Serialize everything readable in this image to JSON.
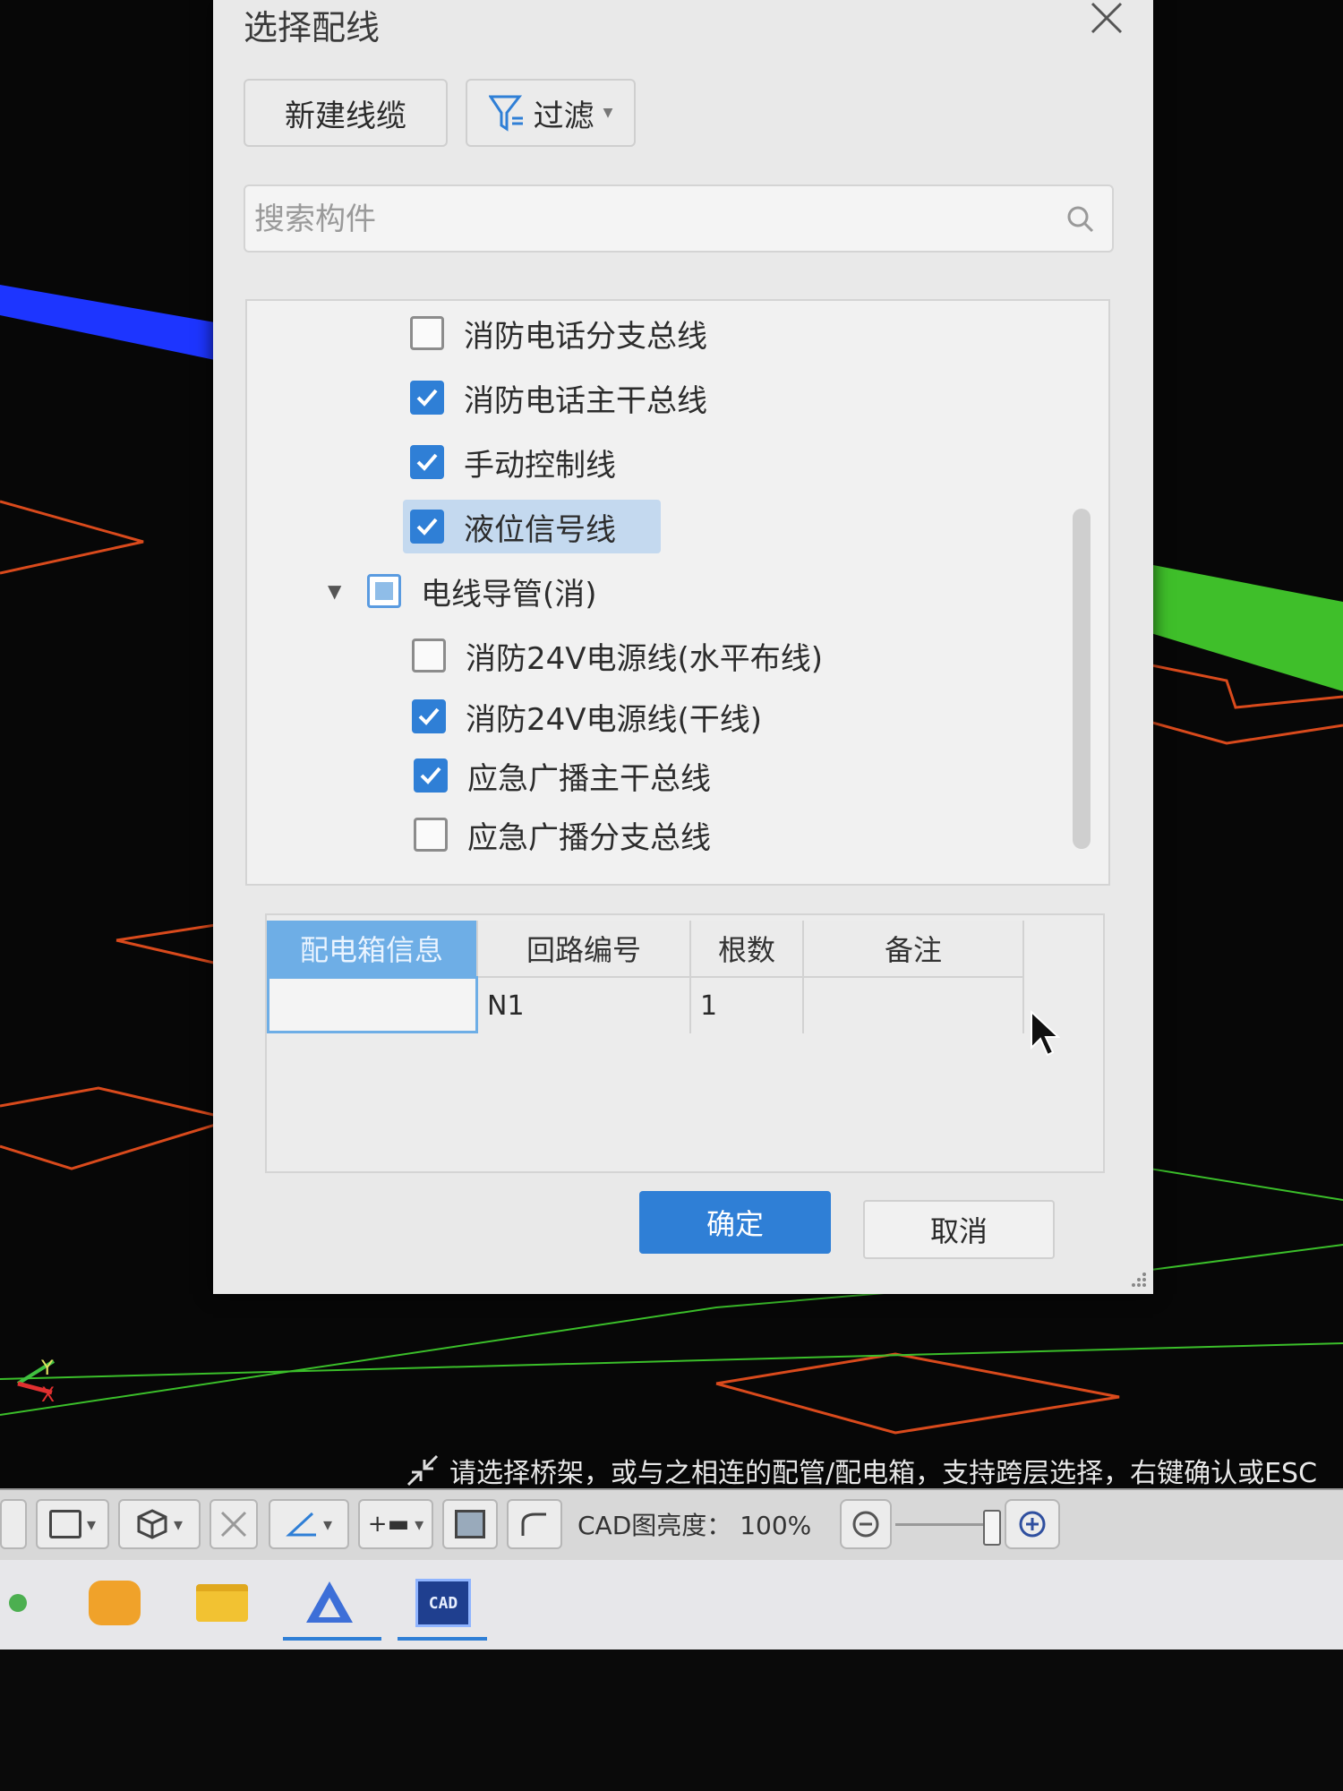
{
  "dialog": {
    "title": "选择配线",
    "new_cable_label": "新建线缆",
    "filter_label": "过滤",
    "search_placeholder": "搜索构件",
    "tree_items": [
      {
        "label": "消防电话分支总线",
        "checked": false
      },
      {
        "label": "消防电话主干总线",
        "checked": true
      },
      {
        "label": "手动控制线",
        "checked": true
      },
      {
        "label": "液位信号线",
        "checked": true,
        "selected": true
      },
      {
        "label": "电线导管(消)",
        "checked": "partial",
        "group": true
      },
      {
        "label": "消防24V电源线(水平布线)",
        "checked": false
      },
      {
        "label": "消防24V电源线(干线)",
        "checked": true
      },
      {
        "label": "应急广播主干总线",
        "checked": true
      },
      {
        "label": "应急广播分支总线",
        "checked": false
      }
    ],
    "table": {
      "headers": [
        "配电箱信息",
        "回路编号",
        "根数",
        "备注"
      ],
      "row": [
        "",
        "N1",
        "1",
        ""
      ]
    },
    "ok_label": "确定",
    "cancel_label": "取消"
  },
  "status": {
    "prompt": "请选择桥架，或与之相连的配管/配电箱，支持跨层选择，右键确认或ESC"
  },
  "toolbar": {
    "brightness_label": "CAD图亮度：",
    "brightness_value": "100%"
  },
  "taskbar": {
    "cad_label": "CAD"
  },
  "colors": {
    "accent": "#2f7fd6",
    "header_highlight": "#6eaee6",
    "cad_orange": "#d94a1c",
    "cad_green": "#3bbf2a",
    "cad_blue": "#1a3cff"
  }
}
